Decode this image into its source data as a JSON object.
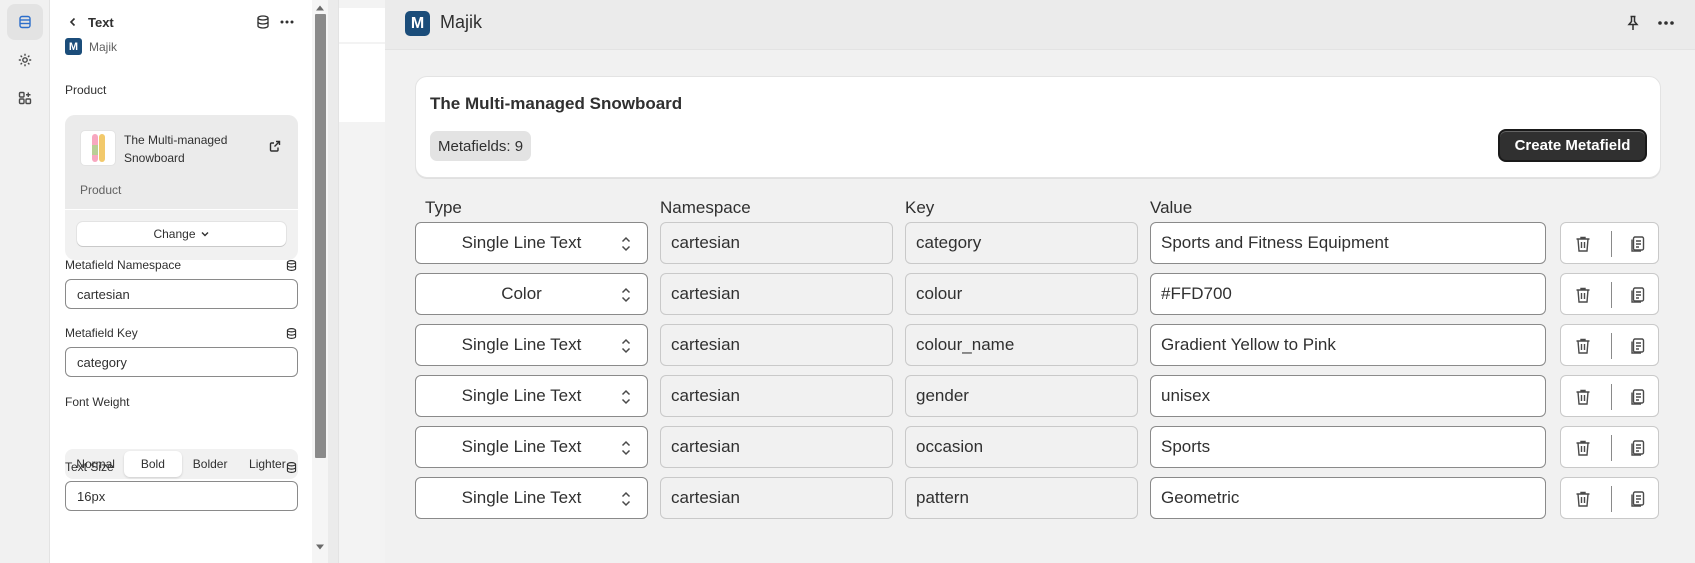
{
  "sidebar_panel": {
    "back_title": "Text",
    "app_name": "Majik",
    "app_logo_letter": "M",
    "product_section_label": "Product",
    "product": {
      "name": "The Multi-managed Snowboard",
      "type": "Product",
      "change_label": "Change"
    },
    "namespace_label": "Metafield Namespace",
    "namespace_value": "cartesian",
    "key_label": "Metafield Key",
    "key_value": "category",
    "font_weight_label": "Font Weight",
    "font_weights": [
      "Normal",
      "Bold",
      "Bolder",
      "Lighter"
    ],
    "font_weight_selected": "Bold",
    "text_size_label": "Text Size",
    "text_size_value": "16px"
  },
  "app": {
    "logo_letter": "M",
    "title": "Majik",
    "product_title": "The Multi-managed Snowboard",
    "metafields_badge": "Metafields: 9",
    "create_button": "Create Metafield",
    "columns": [
      "Type",
      "Namespace",
      "Key",
      "Value"
    ],
    "rows": [
      {
        "type": "Single Line Text",
        "namespace": "cartesian",
        "key": "category",
        "value": "Sports and Fitness Equipment"
      },
      {
        "type": "Color",
        "namespace": "cartesian",
        "key": "colour",
        "value": "#FFD700"
      },
      {
        "type": "Single Line Text",
        "namespace": "cartesian",
        "key": "colour_name",
        "value": "Gradient Yellow to Pink"
      },
      {
        "type": "Single Line Text",
        "namespace": "cartesian",
        "key": "gender",
        "value": "unisex"
      },
      {
        "type": "Single Line Text",
        "namespace": "cartesian",
        "key": "occasion",
        "value": "Sports"
      },
      {
        "type": "Single Line Text",
        "namespace": "cartesian",
        "key": "pattern",
        "value": "Geometric"
      }
    ]
  },
  "colors": {
    "brand": "#1b4d7a",
    "accent_blue": "#2c6ecb",
    "primary_button": "#303030"
  },
  "icons": {
    "rail": [
      "sections-icon",
      "gear-icon",
      "apps-icon"
    ],
    "row_actions": [
      "trash-icon",
      "copy-icon"
    ]
  }
}
